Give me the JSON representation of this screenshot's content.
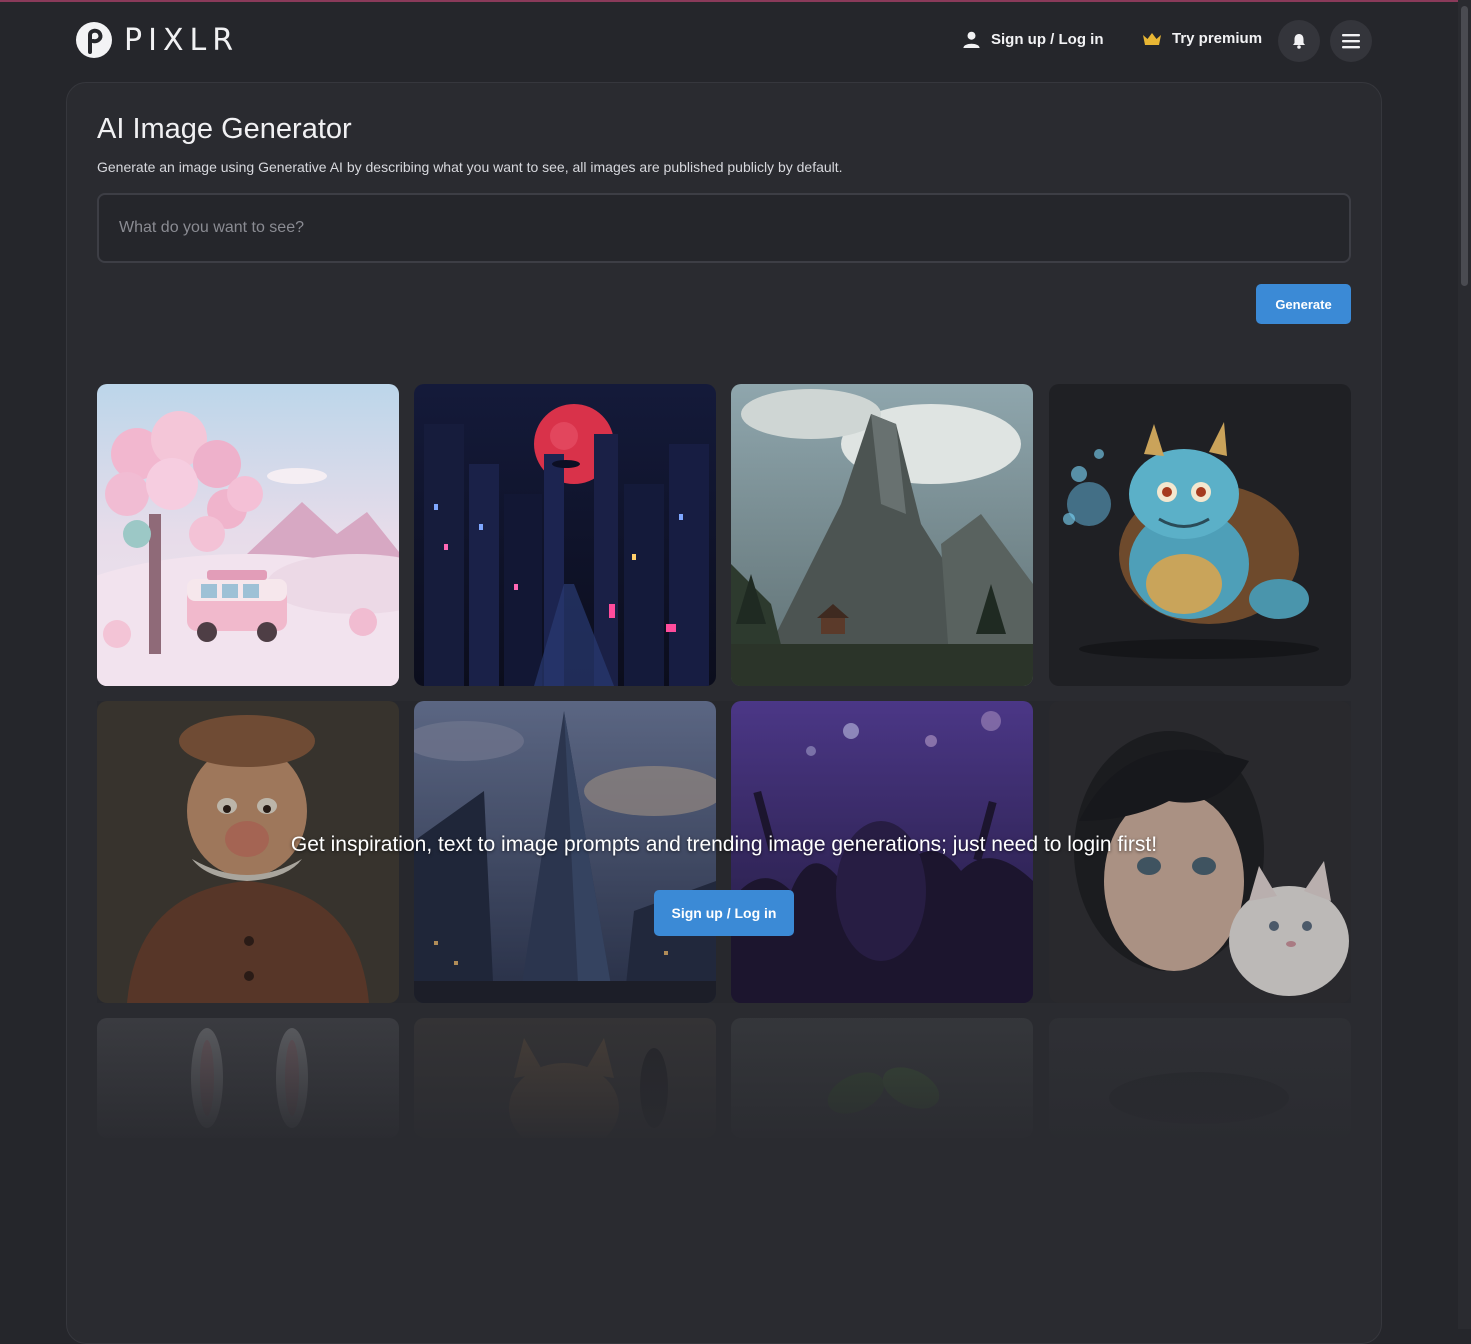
{
  "app": {
    "logo_text": "PIXLR",
    "accent_color": "#3b8ad6",
    "background_color": "#25262b"
  },
  "header": {
    "signup_label": "Sign up / Log in",
    "premium_label": "Try premium",
    "icons": [
      "user-icon",
      "crown-icon",
      "bell-icon",
      "hamburger-menu-icon"
    ]
  },
  "main": {
    "title": "AI Image Generator",
    "subtitle": "Generate an image using Generative AI by describing what you want to see, all images are published publicly by default.",
    "prompt_placeholder": "What do you want to see?",
    "prompt_value": "",
    "generate_label": "Generate"
  },
  "gallery": {
    "overlay_text": "Get inspiration, text to image prompts and trending image generations; just need to login first!",
    "overlay_button_label": "Sign up / Log in",
    "images": [
      "pastel-tree-van-image",
      "neon-city-red-moon-image",
      "mountain-cabin-landscape-image",
      "turtle-dragon-creature-image",
      "cartoon-old-man-image",
      "skyscraper-sky-image",
      "concert-crowd-image",
      "anime-girl-kitten-image",
      "white-rabbit-image",
      "cat-face-image",
      "green-plant-image",
      "dark-vehicle-image"
    ]
  }
}
